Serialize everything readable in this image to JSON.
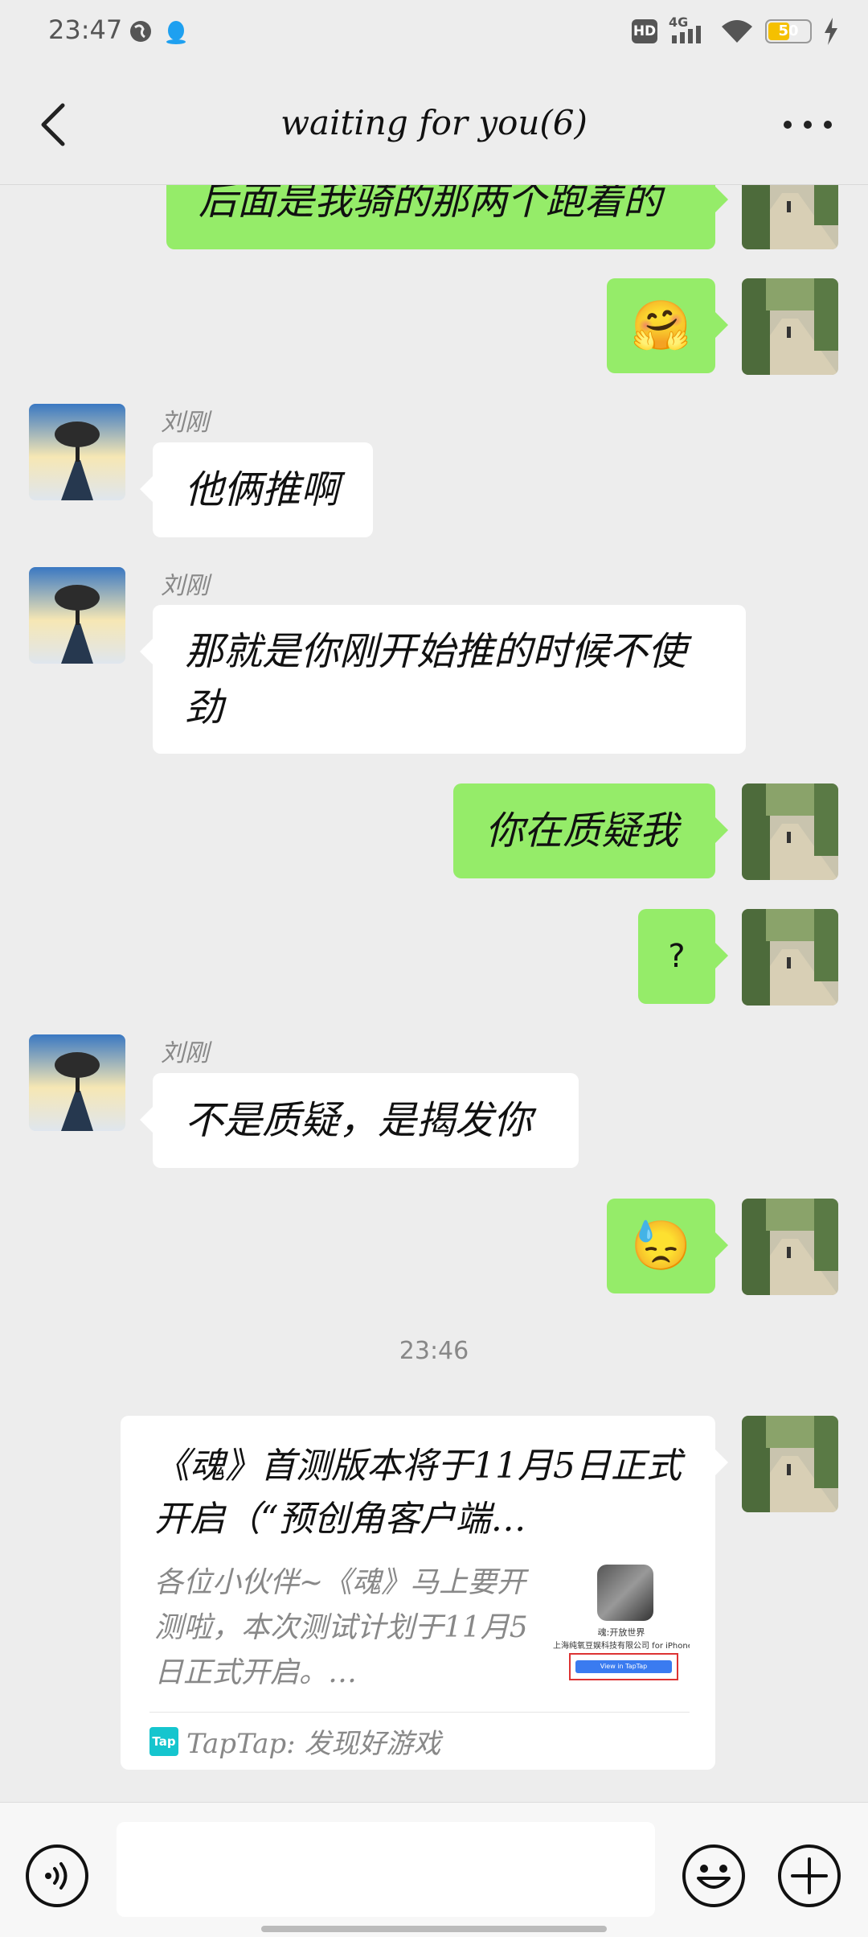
{
  "status_bar": {
    "time": "23:47",
    "network": "4G",
    "hd": "HD",
    "battery": "50"
  },
  "header": {
    "title": "waiting for you(6)"
  },
  "messages": [
    {
      "side": "mine",
      "text": "后面是我骑的那两个跑着的"
    },
    {
      "side": "mine",
      "text": "🤗"
    },
    {
      "side": "theirs",
      "sender": "刘刚",
      "text": "他俩推啊"
    },
    {
      "side": "theirs",
      "sender": "刘刚",
      "text": "那就是你刚开始推的时候不使劲"
    },
    {
      "side": "mine",
      "text": "你在质疑我"
    },
    {
      "side": "mine",
      "text": "?"
    },
    {
      "side": "theirs",
      "sender": "刘刚",
      "text": "不是质疑，是揭发你"
    },
    {
      "side": "mine",
      "text": "😓"
    }
  ],
  "timestamp": "23:46",
  "link_card": {
    "title": "《魂》首测版本将于11月5日正式开启（“预创角客户端…",
    "description": "各位小伙伴~《魂》马上要开测啦，本次测试计划于11月5日正式开启。…",
    "thumb_name": "魂:开放世界",
    "thumb_company": "上海纯氧豆娱科技有限公司 for iPhone",
    "thumb_button": "View in TapTap",
    "source_logo": "Tap",
    "source": "TapTap: 发现好游戏"
  },
  "input": {
    "value": ""
  },
  "colors": {
    "mine_bubble": "#95ec69",
    "theirs_bubble": "#ffffff",
    "background": "#ededed"
  }
}
